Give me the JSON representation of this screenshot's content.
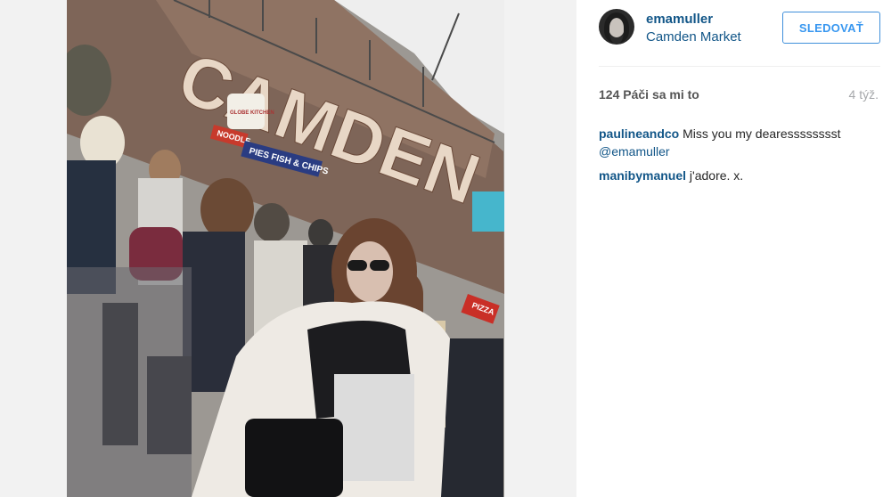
{
  "post": {
    "username": "emamuller",
    "location": "Camden Market",
    "follow_label": "SLEDOVAŤ",
    "likes": "124 Páči sa mi to",
    "time": "4 týž."
  },
  "photo": {
    "sign_main": "CAMDEN",
    "sign_shop": "PIES FISH & CHIPS",
    "sign_globe": "GLOBE KITCHEN",
    "sign_noodle": "NOODLE",
    "sign_pizza": "PIZZA"
  },
  "comments": [
    {
      "author": "paulineandco",
      "text": "Miss you my dearesssssssst",
      "mention": "@emamuller"
    },
    {
      "author": "manibymanuel",
      "text": "j'adore. x."
    }
  ],
  "colors": {
    "link": "#125688",
    "follow": "#3897f0"
  }
}
